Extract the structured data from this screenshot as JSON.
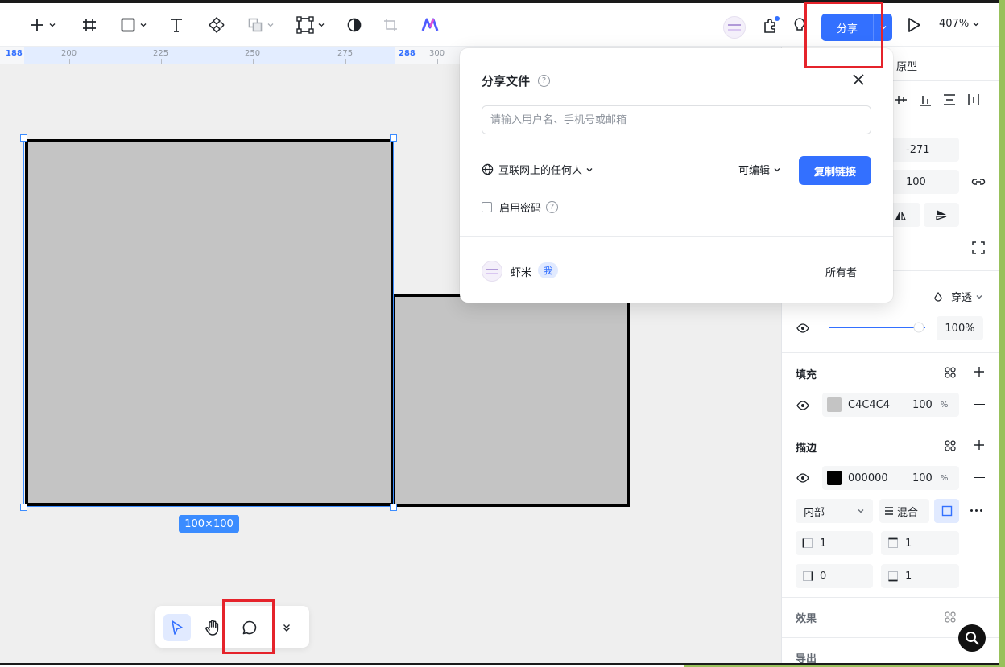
{
  "toolbar": {
    "share_label": "分享",
    "zoom_label": "407%"
  },
  "ruler": {
    "labels": [
      "188",
      "200",
      "225",
      "250",
      "275",
      "288",
      "300"
    ]
  },
  "canvas": {
    "size_badge": "100×100"
  },
  "share_dialog": {
    "title": "分享文件",
    "input_placeholder": "请输入用户名、手机号或邮箱",
    "access_scope": "互联网上的任何人",
    "permission": "可编辑",
    "copy_link_label": "复制链接",
    "password_label": "启用密码",
    "member": {
      "name": "虾米",
      "badge": "我",
      "role": "所有者"
    }
  },
  "panel": {
    "tab_prototype": "原型",
    "position_y": "-271",
    "height": "100",
    "blend_mode": "穿透",
    "opacity": "100%",
    "opacity_fraction": 1.0,
    "fill": {
      "title": "填充",
      "hex": "C4C4C4",
      "opacity": "100",
      "pct": "%",
      "color": "#c4c4c4"
    },
    "stroke": {
      "title": "描边",
      "hex": "000000",
      "opacity": "100",
      "pct": "%",
      "color": "#000000",
      "position": "内部",
      "mode": "混合",
      "widths": [
        "1",
        "1",
        "0",
        "1"
      ]
    },
    "effects_title": "效果",
    "export_title": "导出"
  },
  "colors": {
    "accent": "#3370ff",
    "highlight": "#e5232b"
  }
}
